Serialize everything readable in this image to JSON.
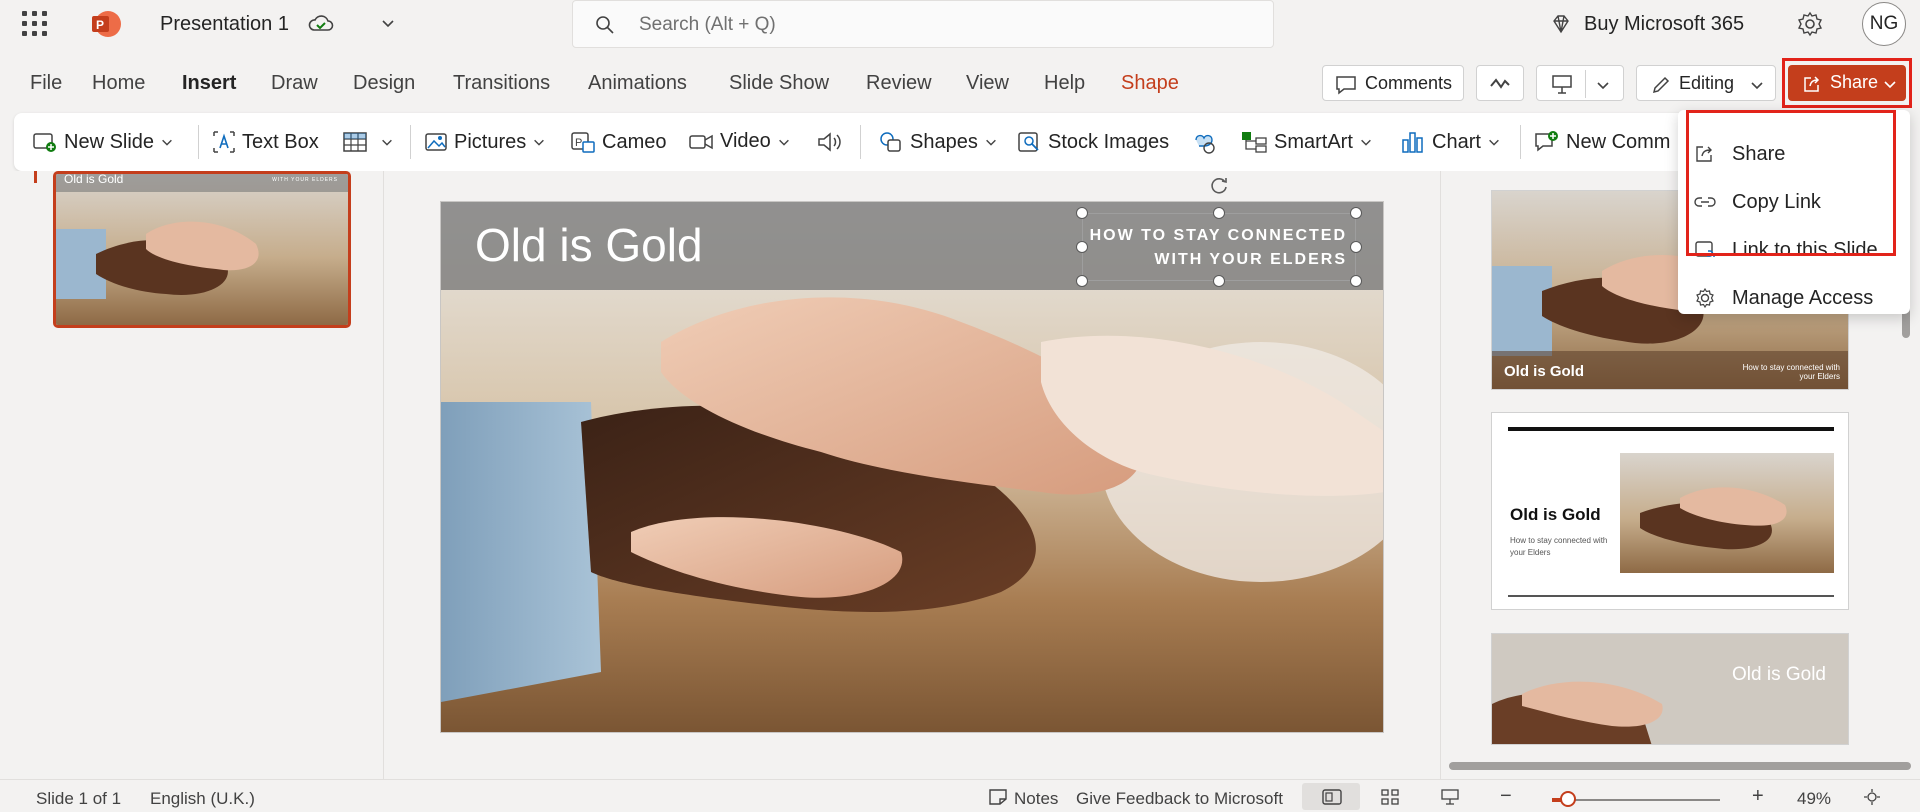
{
  "app": {
    "title": "Presentation 1",
    "search_placeholder": "Search (Alt + Q)",
    "buy_label": "Buy Microsoft 365",
    "avatar_initials": "NG"
  },
  "menu": {
    "items": [
      "File",
      "Home",
      "Insert",
      "Draw",
      "Design",
      "Transitions",
      "Animations",
      "Slide Show",
      "Review",
      "View",
      "Help",
      "Shape"
    ],
    "active": "Insert",
    "comments_label": "Comments",
    "editing_label": "Editing",
    "share_label": "Share"
  },
  "ribbon": {
    "new_slide": "New Slide",
    "text_box": "Text Box",
    "pictures": "Pictures",
    "cameo": "Cameo",
    "video": "Video",
    "shapes": "Shapes",
    "stock_images": "Stock Images",
    "smartart": "SmartArt",
    "chart": "Chart",
    "new_comment": "New Comm"
  },
  "thumbnail": {
    "title": "Old is Gold",
    "subtitle": "WITH YOUR ELDERS"
  },
  "slide": {
    "title": "Old is Gold",
    "subtitle": "HOW TO STAY CONNECTED WITH YOUR ELDERS"
  },
  "design_ideas": [
    {
      "title": "Old is Gold",
      "subtitle": "How to stay connected with your Elders"
    },
    {
      "title": "Old is Gold",
      "subtitle": "How to stay connected with your Elders"
    },
    {
      "title": "Old is Gold"
    }
  ],
  "share_menu": {
    "items": [
      "Share",
      "Copy Link",
      "Link to this Slide",
      "Manage Access"
    ]
  },
  "status": {
    "slide_count": "Slide 1 of 1",
    "language": "English (U.K.)",
    "notes": "Notes",
    "feedback": "Give Feedback to Microsoft",
    "zoom": "49%"
  },
  "colors": {
    "accent": "#c43e1c",
    "highlight": "#e2231a"
  }
}
